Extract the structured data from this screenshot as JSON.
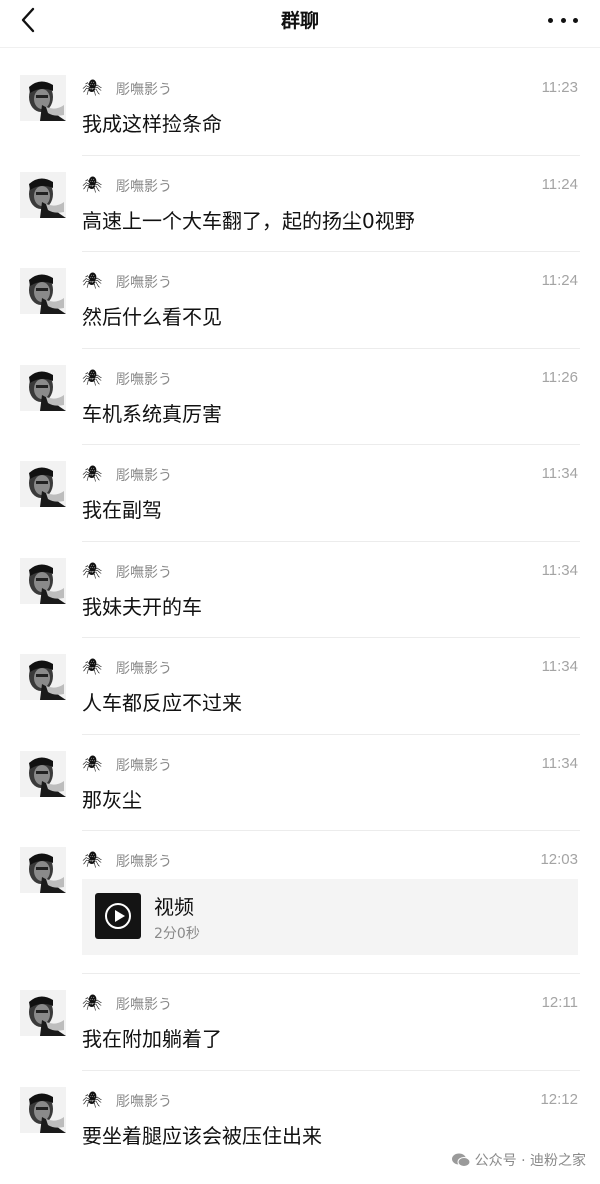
{
  "header": {
    "title": "群聊"
  },
  "sender_name": "彫嘸影う",
  "messages": [
    {
      "time": "11:23",
      "text": "我成这样捡条命"
    },
    {
      "time": "11:24",
      "text": "高速上一个大车翻了，起的扬尘0视野"
    },
    {
      "time": "11:24",
      "text": "然后什么看不见"
    },
    {
      "time": "11:26",
      "text": "车机系统真厉害"
    },
    {
      "time": "11:34",
      "text": "我在副驾"
    },
    {
      "time": "11:34",
      "text": "我妹夫开的车"
    },
    {
      "time": "11:34",
      "text": "人车都反应不过来"
    },
    {
      "time": "11:34",
      "text": "那灰尘"
    },
    {
      "time": "12:03",
      "video": {
        "title": "视频",
        "duration": "2分0秒"
      }
    },
    {
      "time": "12:11",
      "text": "我在附加躺着了"
    },
    {
      "time": "12:12",
      "text": "要坐着腿应该会被压住出来"
    }
  ],
  "watermark": {
    "text": "公众号 · 迪粉之家"
  },
  "icons": {
    "back": "chevron-left-icon",
    "more": "more-dots-icon",
    "sender_emoji": "spider-icon",
    "video": "play-icon"
  }
}
